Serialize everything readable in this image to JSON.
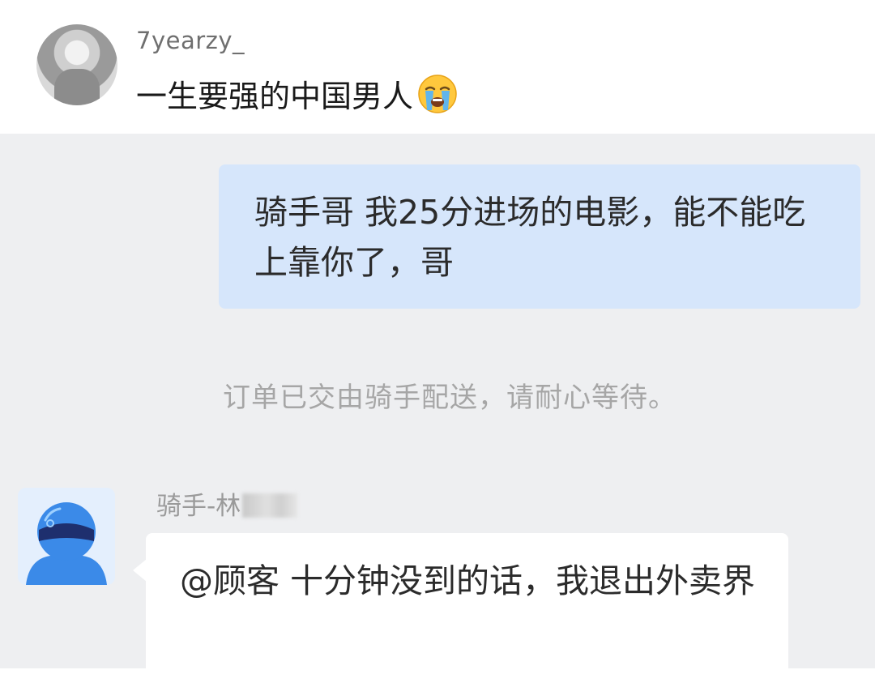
{
  "post": {
    "username": "7yearzy_",
    "text": "一生要强的中国男人",
    "emoji": "loudly-crying-face-emoji"
  },
  "chat": {
    "customer_message": "骑手哥 我25分进场的电影，能不能吃上靠你了，哥",
    "system_notice": "订单已交由骑手配送，请耐心等待。",
    "rider": {
      "name_visible": "骑手-林",
      "name_obscured": true,
      "avatar": "blue-helmet-rider-avatar"
    },
    "rider_message": "@顾客 十分钟没到的话，我退出外卖界"
  },
  "colors": {
    "chat_background": "#eeeff1",
    "customer_bubble": "#d6e6fb",
    "rider_bubble": "#ffffff",
    "system_text": "#a6a6a6",
    "helmet_blue": "#3b8ae8"
  }
}
